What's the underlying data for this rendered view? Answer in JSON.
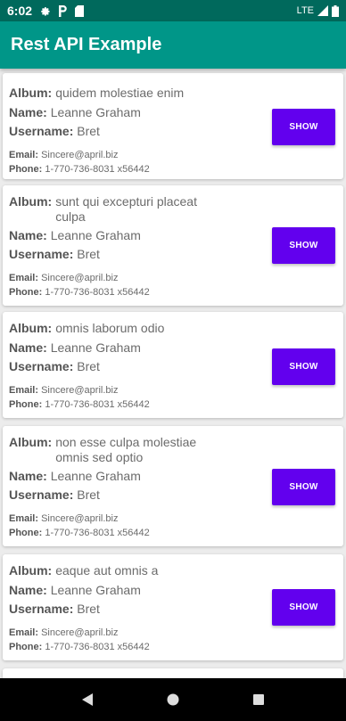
{
  "status_bar": {
    "time": "6:02",
    "network": "LTE",
    "icons": [
      "settings-icon",
      "parking-icon",
      "sd-card-icon",
      "signal-icon",
      "battery-icon"
    ]
  },
  "app_bar": {
    "title": "Rest API Example"
  },
  "labels": {
    "album": "Album:",
    "name": "Name:",
    "username": "Username:",
    "email": "Email:",
    "phone": "Phone:",
    "show": "SHOW"
  },
  "cards": [
    {
      "album": "quidem molestiae enim",
      "name": "Leanne Graham",
      "username": "Bret",
      "email": "Sincere@april.biz",
      "phone": "1-770-736-8031 x56442"
    },
    {
      "album": "sunt qui excepturi placeat culpa",
      "name": "Leanne Graham",
      "username": "Bret",
      "email": "Sincere@april.biz",
      "phone": "1-770-736-8031 x56442"
    },
    {
      "album": "omnis laborum odio",
      "name": "Leanne Graham",
      "username": "Bret",
      "email": "Sincere@april.biz",
      "phone": "1-770-736-8031 x56442"
    },
    {
      "album": "non esse culpa molestiae omnis sed optio",
      "name": "Leanne Graham",
      "username": "Bret",
      "email": "Sincere@april.biz",
      "phone": "1-770-736-8031 x56442"
    },
    {
      "album": "eaque aut omnis a",
      "name": "Leanne Graham",
      "username": "Bret",
      "email": "Sincere@april.biz",
      "phone": "1-770-736-8031 x56442"
    }
  ],
  "nav_bar": {
    "icons": [
      "back-icon",
      "home-icon",
      "recents-icon"
    ]
  },
  "colors": {
    "status_bar": "#00695c",
    "app_bar": "#009688",
    "button": "#6200ee",
    "background": "#ececec"
  }
}
